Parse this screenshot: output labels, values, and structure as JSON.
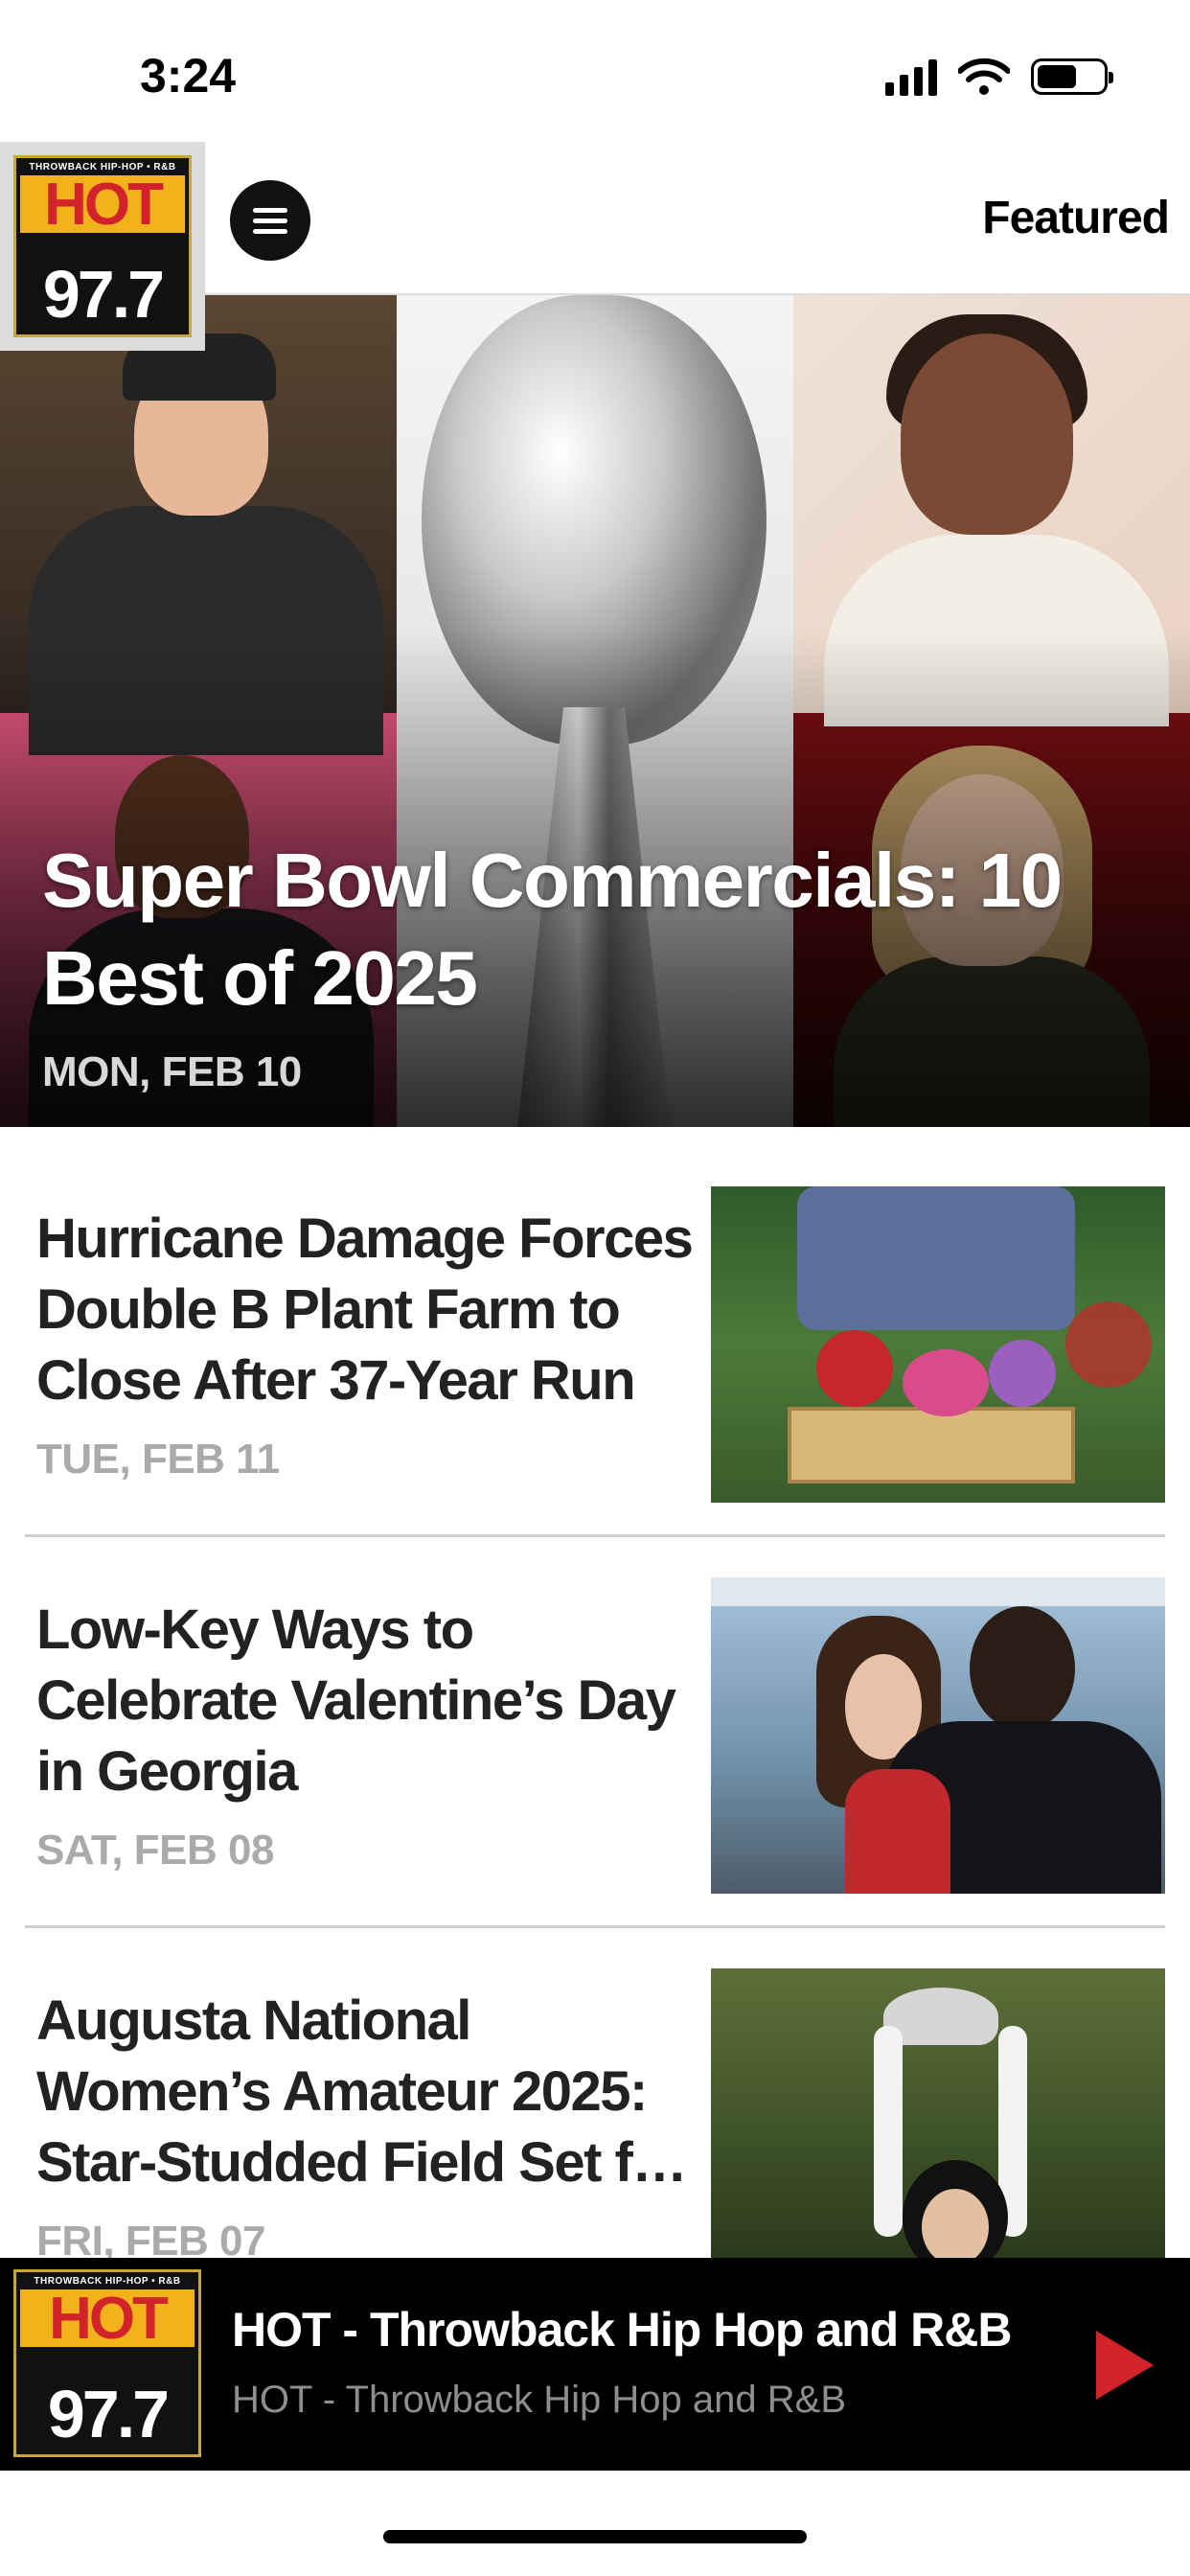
{
  "status_bar": {
    "time": "3:24"
  },
  "header": {
    "logo": {
      "tagline": "THROWBACK HIP-HOP • R&B",
      "word": "HOT",
      "frequency": "97.7"
    },
    "featured_label": "Featured"
  },
  "hero": {
    "title": "Super Bowl Commercials: 10 Best of 2025",
    "date": "MON, FEB 10"
  },
  "stories": [
    {
      "title": "Hurricane Damage Forces Double B Plant Farm to Close After 37-Year Run",
      "date": "TUE, FEB 11"
    },
    {
      "title": "Low-Key Ways to Celebrate Valentine’s Day in Georgia",
      "date": "SAT, FEB 08"
    },
    {
      "title": "Augusta National Women’s Amateur 2025: Star-Studded Field Set f…",
      "date": "FRI, FEB 07"
    }
  ],
  "player": {
    "logo": {
      "tagline": "THROWBACK HIP-HOP • R&B",
      "word": "HOT",
      "frequency": "97.7"
    },
    "title": "HOT - Throwback Hip Hop and R&B",
    "subtitle": "HOT - Throwback Hip Hop and R&B"
  },
  "colors": {
    "brand_red": "#d2232a",
    "brand_gold": "#f2b21b",
    "date_gray": "#aaaaaa"
  }
}
